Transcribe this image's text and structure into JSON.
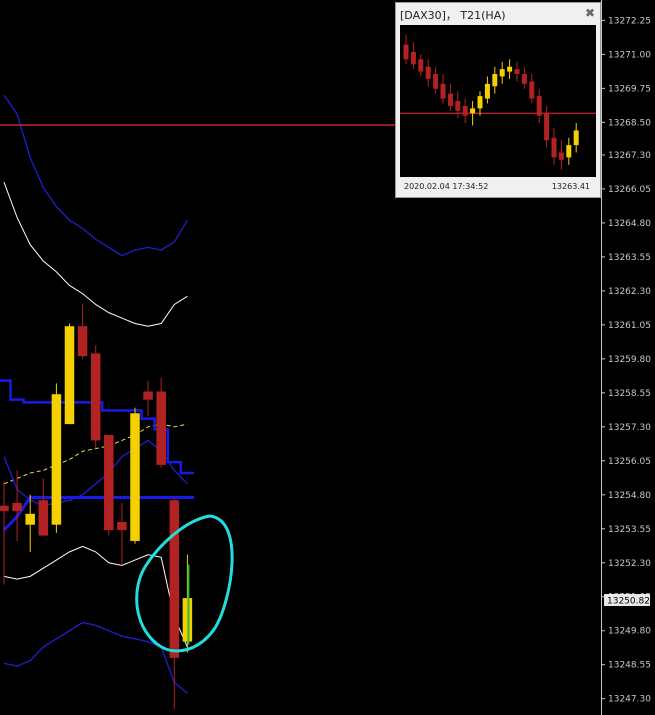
{
  "chart_data": {
    "type": "candlestick",
    "ylim": [
      13246.7,
      13273.0
    ],
    "price_ticks": [
      "13272.25",
      "13271.00",
      "13269.75",
      "13268.50",
      "13267.30",
      "13266.05",
      "13264.80",
      "13263.55",
      "13262.30",
      "13261.05",
      "13259.80",
      "13258.55",
      "13257.30",
      "13256.05",
      "13254.80",
      "13253.55",
      "13252.30",
      "13251.05",
      "13249.80",
      "13248.55",
      "13247.30"
    ],
    "current_price": "13250.82",
    "horizontal_line_price": 13268.4,
    "colors": {
      "bull": "#f5d000",
      "bear": "#b22222",
      "background": "#000000",
      "outer_band": "#1f1fd0",
      "middle_band": "#ffffff",
      "mid_line": "#f0e050",
      "thick_line": "#1a1ae6",
      "hline": "#cc2233",
      "annotation": "#22dddd",
      "current_bar": "#33bb33",
      "badge_bg": "#e8e8e8"
    },
    "candles": [
      {
        "o": 13254.4,
        "h": 13255.3,
        "l": 13251.5,
        "c": 13254.2
      },
      {
        "o": 13254.5,
        "h": 13255.7,
        "l": 13253.1,
        "c": 13254.2
      },
      {
        "o": 13253.7,
        "h": 13254.8,
        "l": 13252.7,
        "c": 13254.1
      },
      {
        "o": 13254.6,
        "h": 13255.4,
        "l": 13253.3,
        "c": 13253.3
      },
      {
        "o": 13253.7,
        "h": 13258.9,
        "l": 13253.4,
        "c": 13258.5
      },
      {
        "o": 13257.4,
        "h": 13261.1,
        "l": 13257.4,
        "c": 13261.0
      },
      {
        "o": 13261.0,
        "h": 13261.8,
        "l": 13259.8,
        "c": 13259.9
      },
      {
        "o": 13260.0,
        "h": 13260.3,
        "l": 13256.5,
        "c": 13256.8
      },
      {
        "o": 13257.0,
        "h": 13257.0,
        "l": 13253.3,
        "c": 13253.5
      },
      {
        "o": 13253.8,
        "h": 13254.5,
        "l": 13252.2,
        "c": 13253.5
      },
      {
        "o": 13253.1,
        "h": 13258.0,
        "l": 13253.0,
        "c": 13257.8
      },
      {
        "o": 13258.6,
        "h": 13259.0,
        "l": 13257.7,
        "c": 13258.3
      },
      {
        "o": 13258.6,
        "h": 13259.1,
        "l": 13255.8,
        "c": 13255.9
      },
      {
        "o": 13254.6,
        "h": 13254.7,
        "l": 13246.9,
        "c": 13248.8
      },
      {
        "o": 13249.4,
        "h": 13252.6,
        "l": 13249.0,
        "c": 13251.0
      }
    ],
    "indicators": {
      "outer_upper": [
        13269.5,
        13268.8,
        13267.2,
        13266.1,
        13265.4,
        13264.9,
        13264.6,
        13264.2,
        13263.9,
        13263.6,
        13263.8,
        13263.9,
        13263.8,
        13264.1,
        13264.9
      ],
      "middle_upper": [
        13266.3,
        13265.0,
        13264.0,
        13263.4,
        13263.0,
        13262.5,
        13262.2,
        13261.8,
        13261.5,
        13261.3,
        13261.1,
        13261.0,
        13261.1,
        13261.8,
        13262.1
      ],
      "mid_line": [
        13255.2,
        13255.4,
        13255.6,
        13255.7,
        13255.9,
        13256.1,
        13256.4,
        13256.5,
        13256.6,
        13256.8,
        13257.0,
        13257.3,
        13257.4,
        13257.3,
        13257.4
      ],
      "middle_lower": [
        13251.8,
        13251.7,
        13251.8,
        13252.1,
        13252.4,
        13252.7,
        13252.9,
        13252.7,
        13252.3,
        13252.2,
        13252.4,
        13252.6,
        13252.5,
        13250.3,
        13249.2
      ],
      "outer_lower": [
        13248.6,
        13248.5,
        13248.7,
        13249.2,
        13249.5,
        13249.8,
        13250.1,
        13250.0,
        13249.8,
        13249.6,
        13249.5,
        13249.4,
        13249.2,
        13247.9,
        13247.5
      ],
      "blue_step": [
        13259.0,
        13258.3,
        13258.2,
        13258.2,
        13258.2,
        13258.2,
        13258.2,
        13258.2,
        13257.9,
        13257.9,
        13257.9,
        13257.6,
        13257.2,
        13256.0,
        13255.6
      ],
      "blue_channel_upper": [
        13256.2,
        13255.0,
        13254.6,
        13254.4,
        13254.5,
        13254.6,
        13254.8,
        13255.2,
        13255.6,
        13256.2,
        13256.5,
        13256.8,
        13256.4,
        13255.7,
        13255.2
      ],
      "thick_line": [
        13253.5,
        13254.0,
        13254.7,
        13254.7,
        13254.7,
        13254.7,
        13254.7,
        13254.7,
        13254.7,
        13254.7,
        13254.7,
        13254.7,
        13254.7,
        13254.7,
        13254.7
      ]
    }
  },
  "mini_window": {
    "title": "[DAX30]， T21(HA)",
    "close_glyph": "✖",
    "footer_time": "2020.02.04 17:34:52",
    "footer_price": "13263.41",
    "candles": [
      {
        "o": 13271.2,
        "h": 13271.6,
        "l": 13270.4,
        "c": 13270.6,
        "d": "dn"
      },
      {
        "o": 13270.9,
        "h": 13271.3,
        "l": 13270.2,
        "c": 13270.4,
        "d": "dn"
      },
      {
        "o": 13270.6,
        "h": 13270.8,
        "l": 13269.9,
        "c": 13270.1,
        "d": "dn"
      },
      {
        "o": 13270.3,
        "h": 13270.6,
        "l": 13269.5,
        "c": 13269.8,
        "d": "dn"
      },
      {
        "o": 13270.0,
        "h": 13270.3,
        "l": 13269.2,
        "c": 13269.4,
        "d": "dn"
      },
      {
        "o": 13269.6,
        "h": 13270.0,
        "l": 13268.8,
        "c": 13269.0,
        "d": "dn"
      },
      {
        "o": 13269.2,
        "h": 13269.6,
        "l": 13268.5,
        "c": 13268.7,
        "d": "dn"
      },
      {
        "o": 13268.9,
        "h": 13269.3,
        "l": 13268.2,
        "c": 13268.5,
        "d": "dn"
      },
      {
        "o": 13268.7,
        "h": 13269.0,
        "l": 13268.0,
        "c": 13268.3,
        "d": "dn"
      },
      {
        "o": 13268.4,
        "h": 13268.9,
        "l": 13267.9,
        "c": 13268.6,
        "d": "up"
      },
      {
        "o": 13268.6,
        "h": 13269.3,
        "l": 13268.3,
        "c": 13269.1,
        "d": "up"
      },
      {
        "o": 13269.0,
        "h": 13269.9,
        "l": 13268.8,
        "c": 13269.6,
        "d": "up"
      },
      {
        "o": 13269.5,
        "h": 13270.3,
        "l": 13269.2,
        "c": 13270.0,
        "d": "up"
      },
      {
        "o": 13269.9,
        "h": 13270.5,
        "l": 13269.6,
        "c": 13270.2,
        "d": "up"
      },
      {
        "o": 13270.1,
        "h": 13270.6,
        "l": 13269.8,
        "c": 13270.3,
        "d": "up"
      },
      {
        "o": 13270.2,
        "h": 13270.5,
        "l": 13269.7,
        "c": 13270.0,
        "d": "dn"
      },
      {
        "o": 13270.0,
        "h": 13270.3,
        "l": 13269.4,
        "c": 13269.6,
        "d": "dn"
      },
      {
        "o": 13269.7,
        "h": 13270.0,
        "l": 13268.8,
        "c": 13269.0,
        "d": "dn"
      },
      {
        "o": 13269.1,
        "h": 13269.4,
        "l": 13268.0,
        "c": 13268.3,
        "d": "dn"
      },
      {
        "o": 13268.4,
        "h": 13268.7,
        "l": 13267.0,
        "c": 13267.3,
        "d": "dn"
      },
      {
        "o": 13267.4,
        "h": 13267.8,
        "l": 13266.3,
        "c": 13266.6,
        "d": "dn"
      },
      {
        "o": 13266.8,
        "h": 13267.3,
        "l": 13266.1,
        "c": 13266.5,
        "d": "dn"
      },
      {
        "o": 13266.6,
        "h": 13267.4,
        "l": 13266.3,
        "c": 13267.1,
        "d": "up"
      },
      {
        "o": 13267.1,
        "h": 13268.0,
        "l": 13266.8,
        "c": 13267.7,
        "d": "up"
      }
    ],
    "ylim": [
      13265.8,
      13272.0
    ],
    "hline": 13268.4
  }
}
